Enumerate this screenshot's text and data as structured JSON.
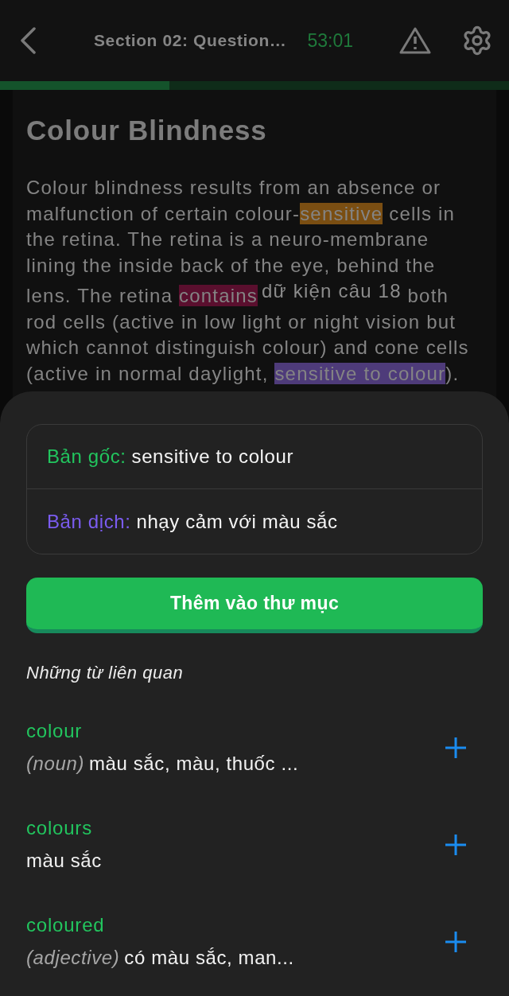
{
  "header": {
    "title": "Section 02: Question…",
    "timer": "53:01"
  },
  "progress": {
    "level": 0.333
  },
  "passage": {
    "title": "Colour Blindness",
    "segments": [
      {
        "kind": "text",
        "text": "Colour blindness results from an absence or malfunction of certain colour-"
      },
      {
        "kind": "highlight",
        "text": "sensitive",
        "color": "#7a4e12"
      },
      {
        "kind": "text",
        "text": " cells in the retina. The retina is a neuro-membrane lining the inside back of the eye, behind the lens. The retina "
      },
      {
        "kind": "highlight",
        "text": "contains",
        "color": "#5a0f2e"
      },
      {
        "kind": "note",
        "text": "dữ kiện câu 18"
      },
      {
        "kind": "text",
        "text": " both rod cells (active in low light or night vision but which cannot distinguish colour) and cone cells (active in normal daylight, "
      },
      {
        "kind": "highlight",
        "text": "sensitive to colour",
        "color": "#4e3b7a"
      },
      {
        "kind": "text",
        "text": ")."
      }
    ]
  },
  "sheet": {
    "original": {
      "label": "Bản gốc:",
      "value": "sensitive to colour"
    },
    "translation": {
      "label": "Bản dịch:",
      "value": "nhạy cảm với màu sắc"
    },
    "button": "Thêm vào thư mục",
    "related_heading": "Những từ liên quan",
    "related": [
      {
        "word": "colour",
        "pos": "(noun)",
        "meaning": "màu sắc, màu, thuốc ..."
      },
      {
        "word": "colours",
        "meaning": "màu sắc"
      },
      {
        "word": "coloured",
        "pos": "(adjective)",
        "meaning": "có màu sắc, man..."
      }
    ]
  }
}
